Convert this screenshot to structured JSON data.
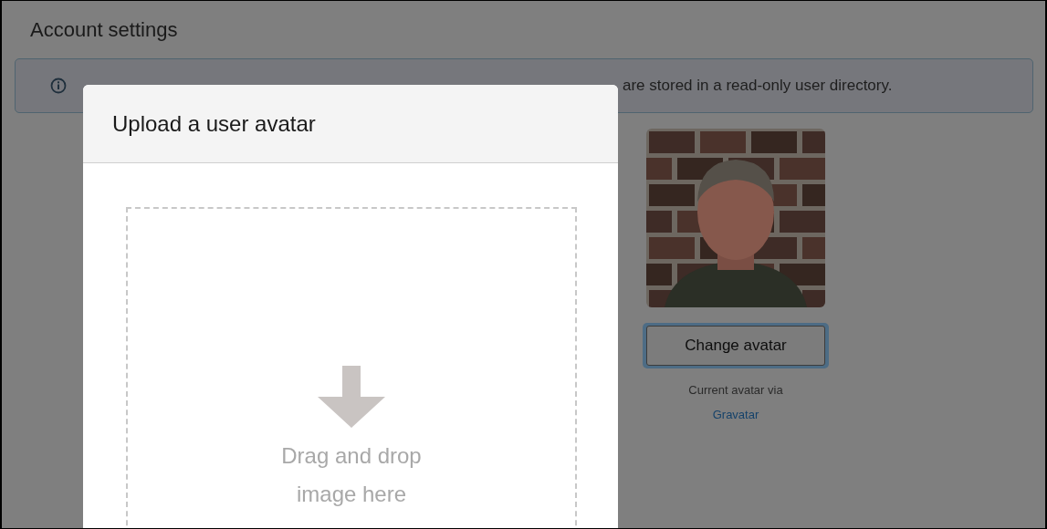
{
  "page": {
    "title": "Account settings"
  },
  "notice": {
    "text": "are stored in a read-only user directory."
  },
  "avatar": {
    "kind": "picture",
    "button": "Change avatar",
    "caption": "Current avatar via",
    "link": "Gravatar"
  },
  "modal": {
    "title": "Upload a user avatar",
    "dropzone_text": "Drag and drop image here"
  }
}
